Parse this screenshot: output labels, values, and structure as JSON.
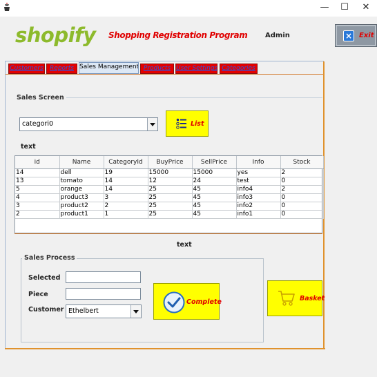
{
  "app": {
    "logo_text": "shopify",
    "title": "Shopping Registration Program",
    "user": "Admin",
    "exit_label": "Exit"
  },
  "window": {
    "minimize": "—",
    "maximize": "☐",
    "close": "✕"
  },
  "tabs": [
    {
      "label": "Customers"
    },
    {
      "label": "Reports"
    },
    {
      "label": "Sales Management"
    },
    {
      "label": "Products"
    },
    {
      "label": "User Settings"
    },
    {
      "label": "Categories"
    }
  ],
  "sales_screen": {
    "section_label": "Sales Screen",
    "category_value": "categori0",
    "list_button": "List",
    "text_label": "text"
  },
  "table": {
    "columns": [
      "id",
      "Name",
      "CategoryId",
      "BuyPrice",
      "SellPrice",
      "Info",
      "Stock"
    ],
    "rows": [
      [
        "14",
        "dell",
        "19",
        "15000",
        "15000",
        "yes",
        "2"
      ],
      [
        "13",
        "tomato",
        "14",
        "12",
        "24",
        "test",
        "0"
      ],
      [
        "5",
        "orange",
        "14",
        "25",
        "45",
        "info4",
        "2"
      ],
      [
        "4",
        "product3",
        "3",
        "25",
        "45",
        "info3",
        "0"
      ],
      [
        "3",
        "product2",
        "2",
        "25",
        "45",
        "info2",
        "0"
      ],
      [
        "2",
        "product1",
        "1",
        "25",
        "45",
        "info1",
        "0"
      ]
    ]
  },
  "middle_text": "text",
  "sales_process": {
    "section_label": "Sales Process",
    "selected_label": "Selected",
    "selected_value": "",
    "piece_label": "Piece",
    "piece_value": "",
    "customer_label": "Customer",
    "customer_value": "Ethelbert",
    "complete_button": "Complete",
    "basket_button": "Basket"
  },
  "colors": {
    "logo_green": "#8dba2c",
    "accent_red": "#e00000",
    "button_yellow": "#ffff00",
    "tab_red": "#e40000",
    "frame_orange": "#e0922d"
  }
}
